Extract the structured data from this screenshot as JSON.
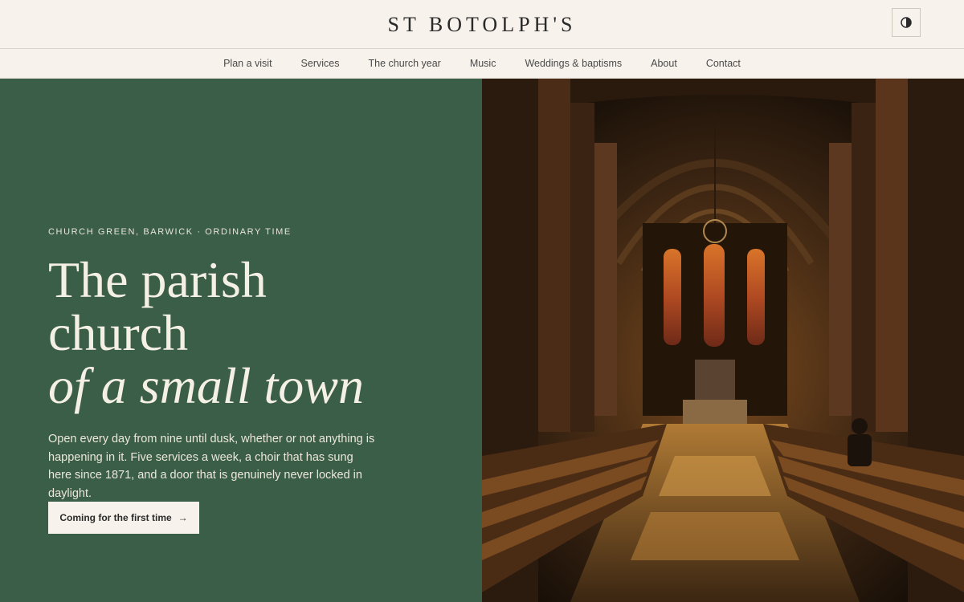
{
  "header": {
    "brand": "ST BOTOLPH'S",
    "theme_toggle_icon": "contrast-icon"
  },
  "nav": {
    "items": [
      {
        "label": "Plan a visit"
      },
      {
        "label": "Services"
      },
      {
        "label": "The church year"
      },
      {
        "label": "Music"
      },
      {
        "label": "Weddings & baptisms"
      },
      {
        "label": "About"
      },
      {
        "label": "Contact"
      }
    ]
  },
  "hero": {
    "eyebrow": "CHURCH GREEN, BARWICK · ORDINARY TIME",
    "headline_line1": "The parish",
    "headline_line2": "church",
    "headline_line3": "of a small town",
    "lede": "Open every day from nine until dusk, whether or not anything is happening in it. Five services a week, a choir that has sung here since 1871, and a door that is genuinely never locked in daylight.",
    "cta_label": "Coming for the first time",
    "cta_icon": "arrow-right-icon",
    "image": "church-interior-photo"
  },
  "colors": {
    "background": "#f7f3ec",
    "hero_green": "#3b5e48",
    "hero_text": "#f5f0e6"
  }
}
